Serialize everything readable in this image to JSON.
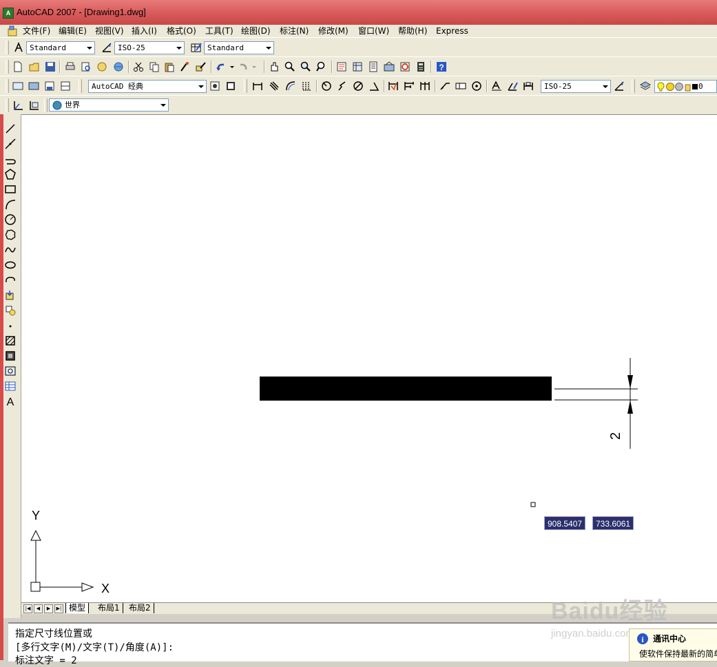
{
  "window": {
    "title": "AutoCAD 2007 - [Drawing1.dwg]"
  },
  "menu": {
    "items": [
      "文件(F)",
      "编辑(E)",
      "视图(V)",
      "插入(I)",
      "格式(O)",
      "工具(T)",
      "绘图(D)",
      "标注(N)",
      "修改(M)",
      "窗口(W)",
      "帮助(H)",
      "Express"
    ]
  },
  "toolbar_styles": {
    "text_style": "Standard",
    "dim_style": "ISO-25",
    "table_style": "Standard"
  },
  "toolbar_workspace": {
    "workspace": "AutoCAD 经典"
  },
  "toolbar_dims": {
    "dim_style": "ISO-25",
    "layer_state": "0"
  },
  "toolbar_ucs": {
    "ucs": "世界"
  },
  "drawing": {
    "dimension_text": "2",
    "coord_x": "908.5407",
    "coord_y": "733.6061",
    "ucs_x": "X",
    "ucs_y": "Y"
  },
  "layout_tabs": [
    "模型",
    "布局1",
    "布局2"
  ],
  "command_lines": [
    "指定尺寸线位置或",
    "[多行文字(M)/文字(T)/角度(A)]:",
    "标注文字 = 2"
  ],
  "notification": {
    "title": "通讯中心",
    "body": "使软件保持最新的简单"
  },
  "watermark": {
    "brand": "Baidu经验",
    "url": "jingyan.baidu.com"
  },
  "colors": {
    "title_bar": "#d65757",
    "canvas": "#ffffff",
    "coord_box": "#2b2f6b"
  }
}
